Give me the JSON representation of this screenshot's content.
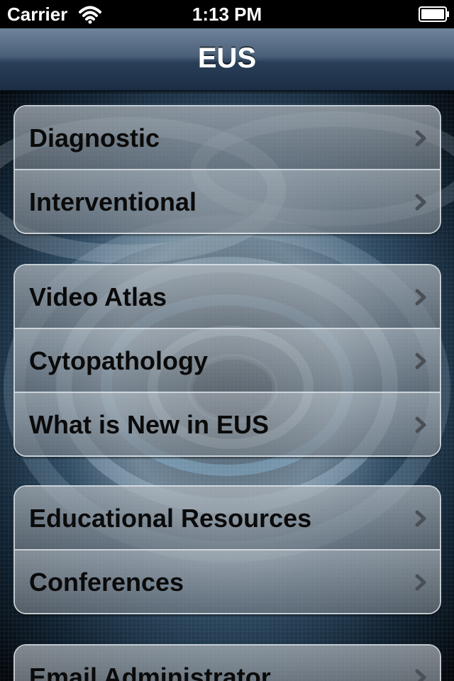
{
  "status_bar": {
    "carrier": "Carrier",
    "time": "1:13 PM"
  },
  "nav_bar": {
    "title": "EUS"
  },
  "groups": [
    {
      "items": [
        {
          "label": "Diagnostic"
        },
        {
          "label": "Interventional"
        }
      ]
    },
    {
      "items": [
        {
          "label": "Video Atlas"
        },
        {
          "label": "Cytopathology"
        },
        {
          "label": "What is New in EUS"
        }
      ]
    },
    {
      "items": [
        {
          "label": "Educational Resources"
        },
        {
          "label": "Conferences"
        }
      ]
    },
    {
      "items": [
        {
          "label": "Email Administrator"
        }
      ]
    }
  ],
  "icons": {
    "disclosure": "chevron-right-icon",
    "wifi": "wifi-icon",
    "battery": "battery-icon"
  },
  "colors": {
    "nav_bar": "#2a3f59",
    "cell_text": "#0a0a0a",
    "chevron": "#4a4f55"
  }
}
